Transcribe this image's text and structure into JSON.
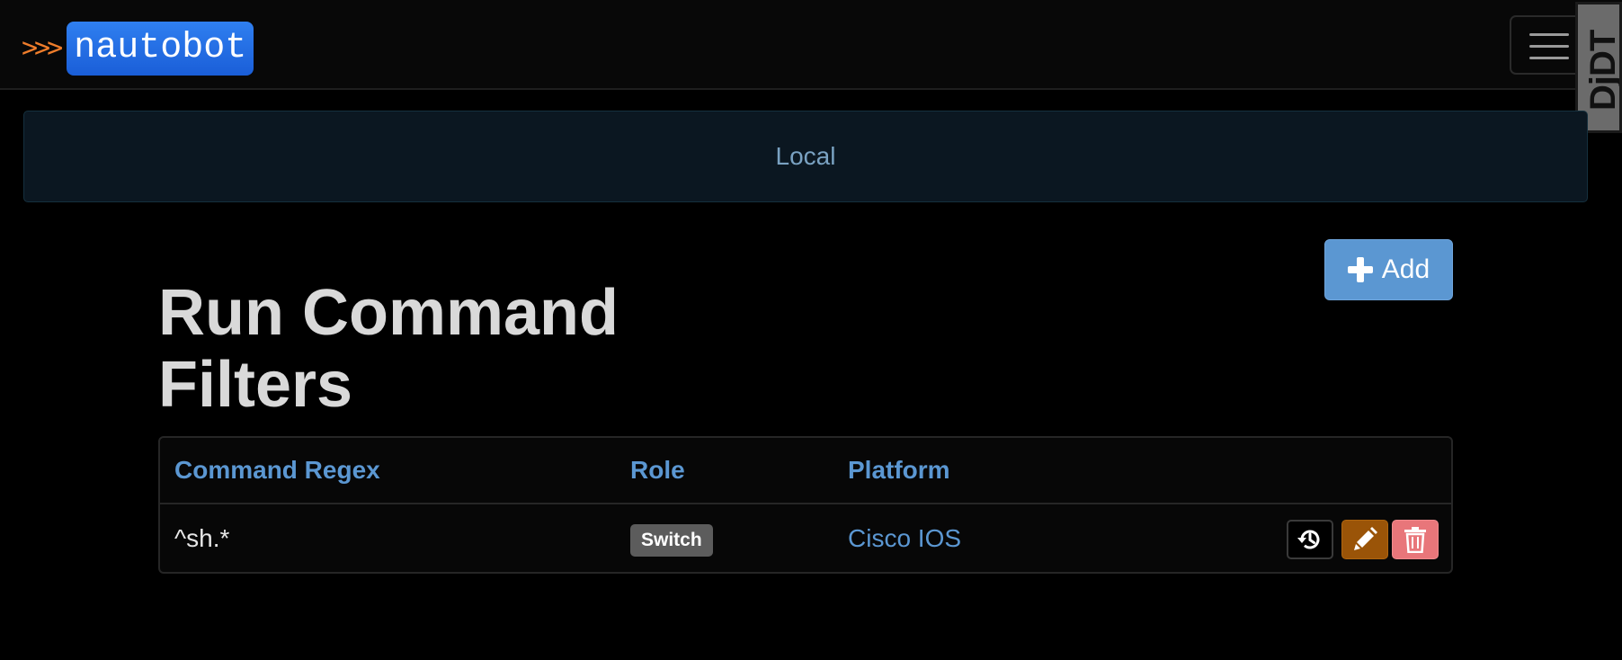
{
  "navbar": {
    "brand_chevrons": ">>>",
    "brand_name": "nautobot"
  },
  "debug_toolbar": {
    "label": "DjDT"
  },
  "environment_banner": {
    "text": "Local"
  },
  "actions": {
    "add_label": "Add"
  },
  "page": {
    "title": "Run Command Filters"
  },
  "table": {
    "columns": [
      "Command Regex",
      "Role",
      "Platform"
    ],
    "rows": [
      {
        "command_regex": "^sh.*",
        "role": "Switch",
        "platform": "Cisco IOS"
      }
    ]
  },
  "colors": {
    "accent": "#5b97d2",
    "brand_orange": "#ef7d2b",
    "brand_blue": "#2270e6",
    "warning": "#9a5408",
    "danger": "#e8767a"
  },
  "icons": {
    "add": "plus-icon",
    "history": "history-icon",
    "edit": "pencil-icon",
    "delete": "trash-icon",
    "menu": "hamburger-menu-icon"
  }
}
